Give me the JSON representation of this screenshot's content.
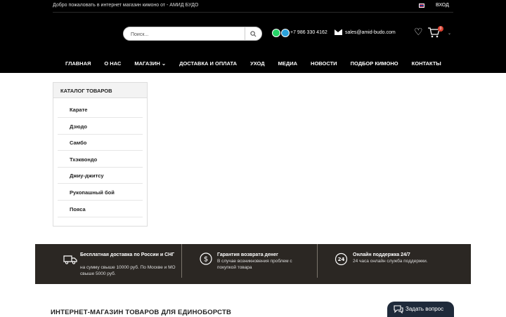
{
  "topbar": {
    "welcome": "Добро пожаловать в интернет магазин кимоно от - АМИД БУДО",
    "login": "ВХОД"
  },
  "search": {
    "placeholder": "Поиск..."
  },
  "contacts": {
    "phone": "+7 986 330 4162",
    "email": "sales@amid-budo.com"
  },
  "cart": {
    "count": "0"
  },
  "nav": [
    {
      "label": "ГЛАВНАЯ"
    },
    {
      "label": "О НАС"
    },
    {
      "label": "МАГАЗИН ⌄"
    },
    {
      "label": "ДОСТАВКА И ОПЛАТА"
    },
    {
      "label": "УХОД"
    },
    {
      "label": "МЕДИА"
    },
    {
      "label": "НОВОСТИ"
    },
    {
      "label": "ПОДБОР КИМОНО"
    },
    {
      "label": "КОНТАКТЫ"
    }
  ],
  "catalog": {
    "title": "КАТАЛОГ ТОВАРОВ",
    "items": [
      "Карате",
      "Дзюдо",
      "Самбо",
      "Тхэквондо",
      "Джиу-джитсу",
      "Рукопашный бой",
      "Пояса"
    ]
  },
  "features": [
    {
      "title": "Бесплатная доставка по России и СНГ",
      "text": "на сумму свыше 10000 руб. По Москве и МО свыше 5000 руб."
    },
    {
      "title": "Гарантия возврата денег",
      "text": "В случае возникновения проблем с покупкой товара"
    },
    {
      "title": "Онлайн поддержка 24/7",
      "text": "24 часа онлайн служба поддержки.",
      "badge": "24"
    }
  ],
  "bottom": {
    "title": "ИНТЕРНЕТ-МАГАЗИН ТОВАРОВ ДЛЯ ЕДИНОБОРСТВ"
  },
  "ask": {
    "label": "Задать вопрос"
  }
}
